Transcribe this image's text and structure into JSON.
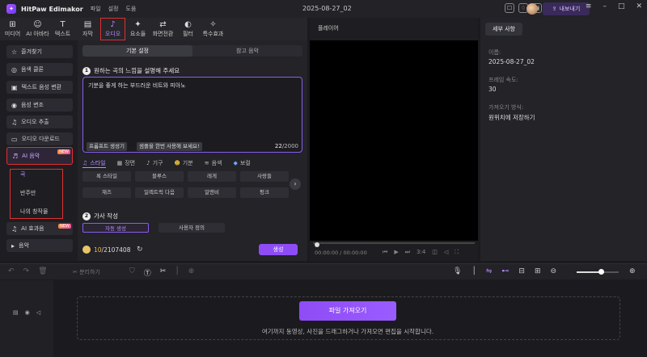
{
  "titlebar": {
    "app_title": "HitPaw Edimakor",
    "menu": [
      "파일",
      "설정",
      "도움"
    ],
    "project_name": "2025-08-27_02",
    "export_label": "내보내기"
  },
  "toolbar": {
    "tools": [
      {
        "label": "미디어",
        "icon": "media-icon",
        "glyph": "⊞"
      },
      {
        "label": "AI 아바타",
        "icon": "ai-avatar-icon",
        "glyph": "☺"
      },
      {
        "label": "텍스트",
        "icon": "text-icon",
        "glyph": "T"
      },
      {
        "label": "자막",
        "icon": "subtitle-icon",
        "glyph": "▤"
      },
      {
        "label": "오디오",
        "icon": "audio-icon",
        "glyph": "♪"
      },
      {
        "label": "요소들",
        "icon": "elements-icon",
        "glyph": "✦"
      },
      {
        "label": "화면전환",
        "icon": "transition-icon",
        "glyph": "⇄"
      },
      {
        "label": "필터",
        "icon": "filter-icon",
        "glyph": "◐"
      },
      {
        "label": "특수효과",
        "icon": "effects-icon",
        "glyph": "✧"
      }
    ]
  },
  "sidebar": {
    "items": [
      {
        "label": "즐겨찾기",
        "glyph": "☆"
      },
      {
        "label": "음색 클론",
        "glyph": "◎"
      },
      {
        "label": "텍스트 음성 변환",
        "glyph": "▣"
      },
      {
        "label": "음성 변조",
        "glyph": "◉"
      },
      {
        "label": "오디오 추출",
        "glyph": "🎙"
      },
      {
        "label": "오디오 다운로드",
        "glyph": "▭"
      }
    ],
    "ai_music": {
      "label": "AI 음악",
      "badge": "NEW"
    },
    "sub_items": [
      "곡",
      "반주만",
      "나의 창작물"
    ],
    "ai_effects": {
      "label": "AI 효과음",
      "badge": "NEW"
    },
    "music": {
      "label": "음악"
    }
  },
  "panel": {
    "tabs": [
      "기본 설정",
      "참고 음악"
    ],
    "step1": {
      "num": "1",
      "label": "원하는 곡의 느낌을 설명해 주세요"
    },
    "prompt_value": "기분을 좋게 하는 부드러운 비트와 피아노",
    "prompt_gen_button": "프롬프트 생성기",
    "sample_button": "샘플을 한번 사용해 보세요!",
    "counter_current": "22",
    "counter_max": "/2000",
    "categories": [
      {
        "label": "스타일",
        "glyph": "♫"
      },
      {
        "label": "장면",
        "glyph": "🎬"
      },
      {
        "label": "기구",
        "glyph": "🎸"
      },
      {
        "label": "기분",
        "glyph": "☻"
      },
      {
        "label": "음색",
        "glyph": "🎚"
      },
      {
        "label": "보컬",
        "glyph": "◆"
      }
    ],
    "styles": [
      "록 스타일",
      "블루스",
      "레게",
      "사랑들",
      "재즈",
      "일렉트릭 다음",
      "알앤비",
      "펑크"
    ],
    "step2": {
      "num": "2",
      "label": "가사 작성"
    },
    "mode_auto": "자동 생성",
    "mode_custom": "사용자 정의",
    "credit_used": "10",
    "credit_total": "/2107408",
    "generate_button": "생성"
  },
  "player": {
    "label": "플레이어",
    "timecode": "00:00:00 / 00:00:00",
    "aspect": "3:4"
  },
  "details": {
    "tab": "세부 사항",
    "name_label": "이름:",
    "name_value": "2025-08-27_02",
    "fps_label": "프레임 속도:",
    "fps_value": "30",
    "import_label": "가져오기 방식:",
    "import_value": "원위치에 저장하기"
  },
  "timeline_toolbar": {
    "split_label": "분리하기"
  },
  "timeline": {
    "import_button": "파일 가져오기",
    "drop_hint": "여기까지 동영상, 사진을 드래그하거나 가져오면 편집을 시작합니다."
  },
  "colors": {
    "accent": "#8e4cf5",
    "highlight_box": "#e03030"
  }
}
